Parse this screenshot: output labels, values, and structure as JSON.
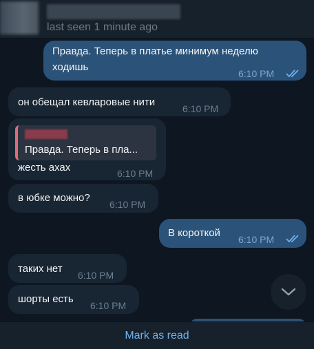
{
  "header": {
    "status": "last seen 1 minute ago"
  },
  "messages": [
    {
      "dir": "out",
      "lines": [
        "Правда. Теперь в платье минимум неделю",
        "ходишь"
      ],
      "time": "6:10 PM"
    },
    {
      "dir": "in",
      "text": "он обещал кевларовые нити",
      "time": "6:10 PM"
    },
    {
      "dir": "in",
      "reply_preview": "Правда. Теперь в пла...",
      "text": "жесть ахах",
      "time": "6:10 PM"
    },
    {
      "dir": "in",
      "text": "в юбке можно?",
      "time": "6:10 PM"
    },
    {
      "dir": "out",
      "text": "В короткой",
      "time": "6:10 PM"
    },
    {
      "dir": "in",
      "text": "таких нет",
      "time": "6:10 PM"
    },
    {
      "dir": "in",
      "text": "шорты есть",
      "time": "6:10 PM"
    }
  ],
  "footer": {
    "mark_read_label": "Mark as read"
  },
  "icons": {
    "read_status": "double-check-icon",
    "scroll_down": "chevron-down-icon"
  },
  "colors": {
    "background": "#0e1621",
    "incoming_bubble": "#182533",
    "outgoing_bubble": "#2b5278",
    "accent": "#6ab3f3"
  }
}
